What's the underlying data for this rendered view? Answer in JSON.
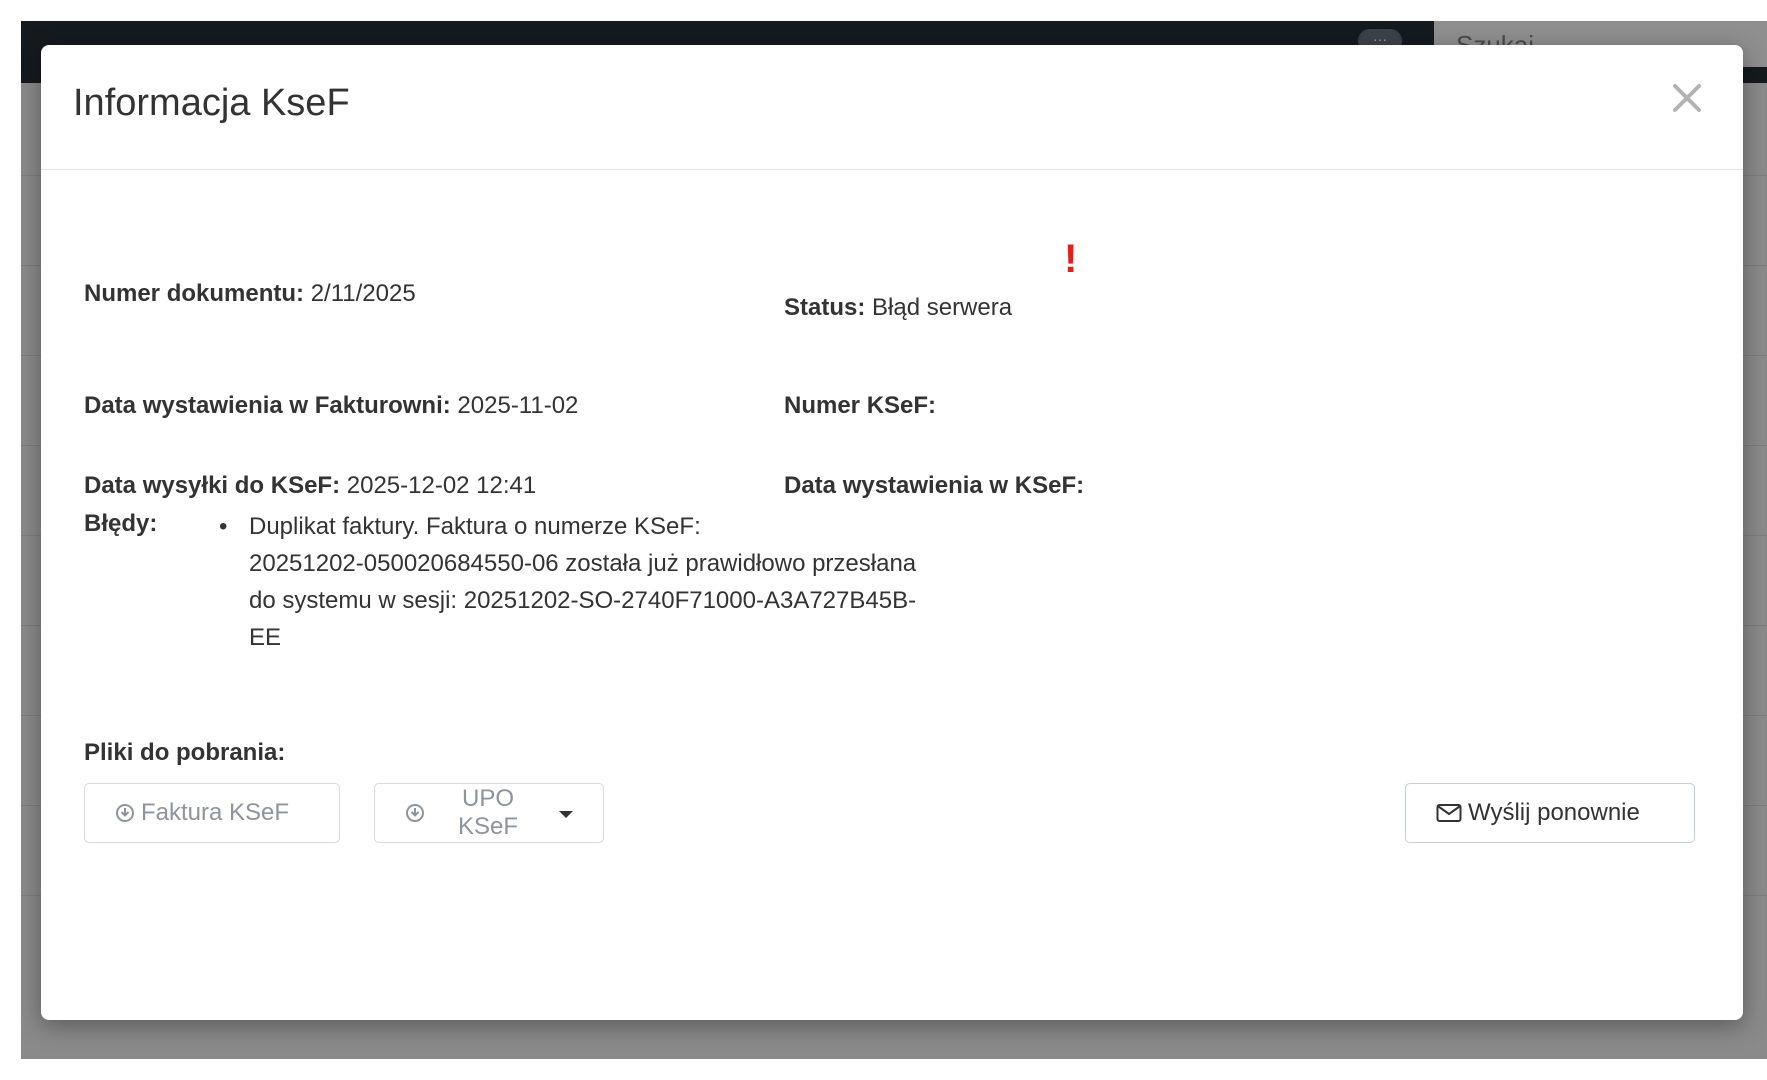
{
  "app": {
    "search_placeholder": "Szukaj",
    "more_label": "···"
  },
  "modal": {
    "title": "Informacja KseF",
    "fields": {
      "document_number": {
        "label": "Numer dokumentu:",
        "value": "2/11/2025"
      },
      "status": {
        "label": "Status:",
        "value": "Błąd serwera",
        "alert": "!"
      },
      "issue_date_fakturownia": {
        "label": "Data wystawienia w Fakturowni:",
        "value": "2025-11-02"
      },
      "ksef_number": {
        "label": "Numer KSeF:",
        "value": ""
      },
      "send_date_ksef": {
        "label": "Data wysyłki do KSeF:",
        "value": "2025-12-02 12:41"
      },
      "issue_date_ksef": {
        "label": "Data wystawienia w KSeF:",
        "value": ""
      }
    },
    "errors": {
      "label": "Błędy:",
      "items": [
        {
          "lines": [
            "Duplikat faktury. Faktura o numerze KSeF:",
            "20251202-050020684550-06 została już prawidłowo przesłana",
            "do systemu w sesji: 20251202-SO-2740F71000-A3A727B45B-",
            "EE"
          ]
        }
      ]
    },
    "downloads": {
      "label": "Pliki do pobrania:",
      "faktura_button": "Faktura KSeF",
      "upo_button": "UPO KSeF"
    },
    "resend_button": "Wyślij ponownie"
  },
  "colors": {
    "alert": "#e0201c",
    "text": "#333333",
    "muted_button_text": "#8d949b"
  }
}
